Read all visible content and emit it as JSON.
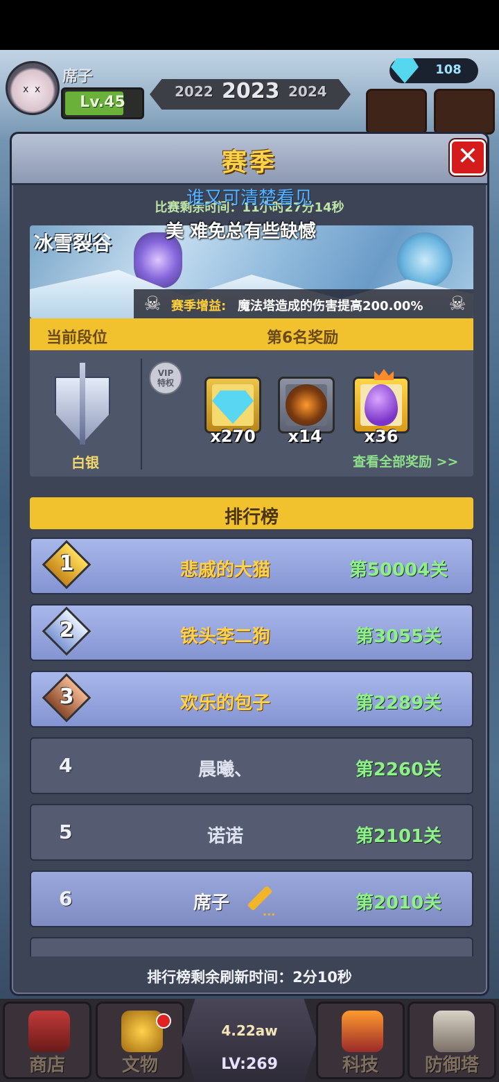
{
  "hud": {
    "player_name": "席子",
    "level": "Lv.45",
    "years": [
      "2022",
      "2023",
      "2024"
    ],
    "gems": "108"
  },
  "modal": {
    "title": "赛季",
    "close": "✕",
    "timer": "比赛剩余时间：11小时27分14秒",
    "overlay_line1": "谁又可清楚看见",
    "overlay_line2": "美 难免总有些缺憾",
    "season": {
      "map_name": "冰雪裂谷",
      "buff_label": "赛季增益:",
      "buff_text": "魔法塔造成的伤害提高200.00%"
    },
    "rank_strip": {
      "current_label": "当前段位",
      "reward_label": "第6名奖励"
    },
    "rank_name": "白银",
    "vip_badge": [
      "VIP",
      "特权"
    ],
    "rewards": [
      {
        "icon": "diamond-icon",
        "count": "x270"
      },
      {
        "icon": "hammer-icon",
        "count": "x14"
      },
      {
        "icon": "egg-icon",
        "count": "x36"
      }
    ],
    "view_all": "查看全部奖励 >>",
    "leaderboard_title": "排行榜",
    "leaderboard": [
      {
        "rank": "1",
        "name": "悲戚的大猫",
        "stage": "第50004关"
      },
      {
        "rank": "2",
        "name": "铁头李二狗",
        "stage": "第3055关"
      },
      {
        "rank": "3",
        "name": "欢乐的包子",
        "stage": "第2289关"
      },
      {
        "rank": "4",
        "name": "晨曦、",
        "stage": "第2260关"
      },
      {
        "rank": "5",
        "name": "诺诺",
        "stage": "第2101关"
      },
      {
        "rank": "6",
        "name": "席子",
        "stage": "第2010关"
      }
    ],
    "refresh": "排行榜剩余刷新时间：2分10秒"
  },
  "bottom_nav": {
    "shop": "商店",
    "relics": "文物",
    "power": "4.22aw",
    "center_level": "LV:269",
    "tech": "科技",
    "defense": "防御塔"
  }
}
